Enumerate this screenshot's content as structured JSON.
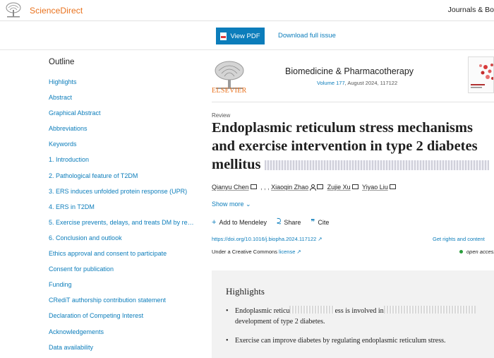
{
  "topbar": {
    "logo_text": "ScienceDirect",
    "journals_link": "Journals & Bo"
  },
  "actions": {
    "view_pdf": "View PDF",
    "download_issue": "Download full issue"
  },
  "outline": {
    "title": "Outline",
    "items": [
      "Highlights",
      "Abstract",
      "Graphical Abstract",
      "Abbreviations",
      "Keywords",
      "1. Introduction",
      "2. Pathological feature of T2DM",
      "3. ERS induces unfolded protein response (UPR)",
      "4. ERS in T2DM",
      "5. Exercise prevents, delays, and treats DM by re…",
      "6. Conclusion and outlook",
      "Ethics approval and consent to participate",
      "Consent for publication",
      "Funding",
      "CRediT authorship contribution statement",
      "Declaration of Competing Interest",
      "Acknowledgements",
      "Data availability"
    ]
  },
  "journal": {
    "publisher": "ELSEVIER",
    "title": "Biomedicine & Pharmacotherapy",
    "volume": "Volume 177",
    "issue_rest": ", August 2024, 117122"
  },
  "article": {
    "type": "Review",
    "title_line1": "Endoplasmic reticulum stress mechanisms",
    "title_line2": "and exercise intervention in type 2 diabetes",
    "title_line3": "mellitus",
    "authors": [
      "Qianyu Chen",
      "Xiaoqin Zhao",
      "Zujie Xu",
      "Yiyao Liu"
    ],
    "author_separator": ", , ,",
    "show_more": "Show more",
    "add_mendeley": "Add to Mendeley",
    "share": "Share",
    "cite": "Cite",
    "doi": "https://doi.org/10.1016/j.biopha.2024.117122",
    "rights": "Get rights and content",
    "license_prefix": "Under a Creative Commons",
    "license_link": "license",
    "open_access": "open access"
  },
  "highlights": {
    "title": "Highlights",
    "item1_a": "Endoplasmic reticu",
    "item1_b": "ess is involved in",
    "item1_c": "development of type 2 diabetes.",
    "item2": "Exercise can improve diabetes by regulating endoplasmic reticulum stress."
  },
  "colors": {
    "link": "#0c7dbb",
    "brand_orange": "#e9711c",
    "button": "#0c7dbb",
    "open_access_dot": "#2a9d3c"
  },
  "icons": [
    "elsevier-tree-icon",
    "pdf-icon",
    "chevron-down-icon",
    "plus-icon",
    "share-icon",
    "quote-icon",
    "external-link-icon",
    "mail-icon",
    "person-icon"
  ]
}
